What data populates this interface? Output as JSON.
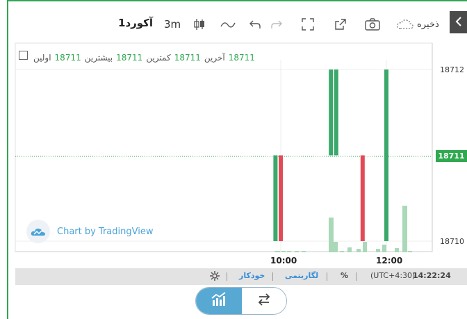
{
  "toolbar": {
    "symbol": "آکورد1",
    "interval": "3m",
    "save_label": "ذخیره"
  },
  "legend": {
    "open_label": "اولین",
    "open_value": "18711",
    "high_label": "بیشترین",
    "high_value": "18711",
    "low_label": "کمترین",
    "low_value": "18711",
    "close_label": "آخرین",
    "close_value": "18711"
  },
  "price_axis": {
    "ticks": [
      "18712",
      "18710"
    ],
    "current_price": "18711"
  },
  "time_axis": {
    "ticks": [
      "10:00",
      "12:00"
    ]
  },
  "watermark": "Chart by TradingView",
  "bottom_bar": {
    "time": "14:22:24",
    "timezone": "(UTC+4:30)",
    "percent": "%",
    "log": "لگاریتمی",
    "auto": "خودکار"
  },
  "colors": {
    "up": "#3aa86a",
    "down": "#e14b57",
    "accent": "#2fa84f",
    "volume": "#a9d9b8"
  },
  "icons": [
    "candlestick-icon",
    "line-icon",
    "undo-icon",
    "redo-icon",
    "fullscreen-icon",
    "popout-icon",
    "camera-icon",
    "cloud-icon",
    "chevron-left-icon",
    "gear-icon",
    "chart-icon",
    "swap-icon"
  ],
  "chart_data": {
    "type": "candlestick",
    "ylim": [
      18709.8,
      18712.1
    ],
    "candles": [
      {
        "x": "09:54",
        "open": 18711,
        "close": 18710,
        "dir": "up"
      },
      {
        "x": "10:00",
        "open": 18711,
        "close": 18710,
        "dir": "down"
      },
      {
        "x": "10:57",
        "open": 18711,
        "close": 18712,
        "dir": "up"
      },
      {
        "x": "11:03",
        "open": 18711,
        "close": 18712,
        "dir": "up"
      },
      {
        "x": "11:33",
        "open": 18711,
        "close": 18710,
        "dir": "down"
      },
      {
        "x": "12:00",
        "open": 18710,
        "close": 18712,
        "dir": "up"
      }
    ]
  }
}
